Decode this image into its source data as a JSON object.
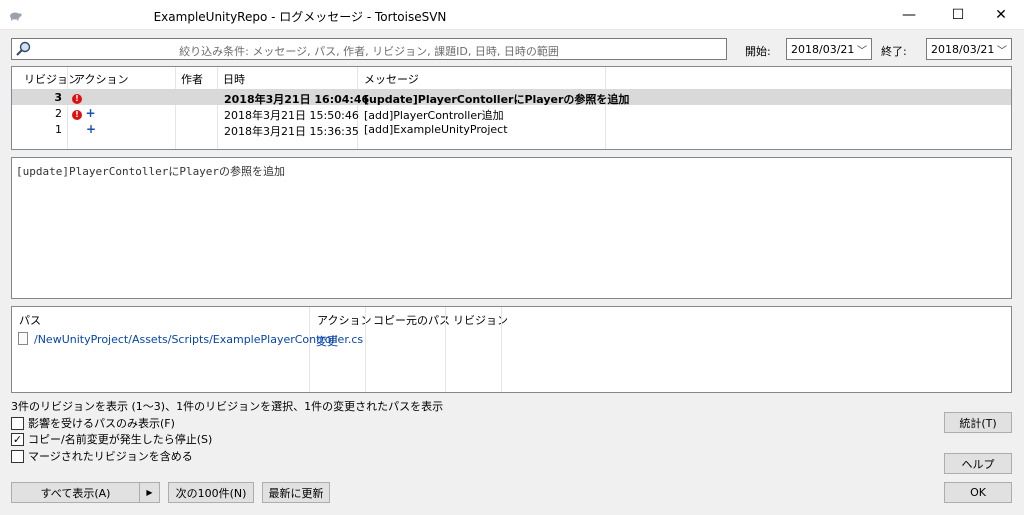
{
  "window": {
    "title": "ExampleUnityRepo - ログメッセージ - TortoiseSVN",
    "minimize": "—",
    "maximize": "☐",
    "close": "✕"
  },
  "filter": {
    "placeholder": "絞り込み条件: メッセージ, パス, 作者, リビジョン, 課題ID, 日時, 日時の範囲",
    "start_label": "開始:",
    "start_date": "2018/03/21",
    "end_label": "終了:",
    "end_date": "2018/03/21"
  },
  "revisions": {
    "headers": [
      "リビジョン",
      "アクション",
      "作者",
      "日時",
      "メッセージ"
    ],
    "rows": [
      {
        "rev": "3",
        "actions": [
          "mod"
        ],
        "author": "",
        "date": "2018年3月21日 16:04:46",
        "message": "[update]PlayerContollerにPlayerの参照を追加",
        "selected": true
      },
      {
        "rev": "2",
        "actions": [
          "mod",
          "add"
        ],
        "author": "",
        "date": "2018年3月21日 15:50:46",
        "message": "[add]PlayerController追加",
        "selected": false
      },
      {
        "rev": "1",
        "actions": [
          "add"
        ],
        "author": "",
        "date": "2018年3月21日 15:36:35",
        "message": "[add]ExampleUnityProject",
        "selected": false
      }
    ]
  },
  "message_text": "[update]PlayerContollerにPlayerの参照を追加",
  "paths": {
    "headers": [
      "パス",
      "アクション",
      "コピー元のパス",
      "リビジョン"
    ],
    "rows": [
      {
        "path": "/NewUnityProject/Assets/Scripts/ExamplePlayerController.cs",
        "action": "変更",
        "copy_from": "",
        "revision": ""
      }
    ]
  },
  "status_text": "3件のリビジョンを表示 (1〜3)、1件のリビジョンを選択、1件の変更されたパスを表示",
  "options": {
    "affected_only": {
      "label": "影響を受けるパスのみ表示(F)",
      "checked": false
    },
    "stop_on_copy": {
      "label": "コピー/名前変更が発生したら停止(S)",
      "checked": true
    },
    "include_merged": {
      "label": "マージされたリビジョンを含める",
      "checked": false
    }
  },
  "buttons": {
    "show_all": "すべて表示(A)",
    "next_100": "次の100件(N)",
    "refresh": "最新に更新",
    "statistics": "統計(T)",
    "help": "ヘルプ",
    "ok": "OK"
  },
  "icons": {
    "app": "tortoise-icon",
    "filter": "search-icon",
    "modified": "modified-icon",
    "added": "added-icon",
    "file": "file-icon"
  }
}
